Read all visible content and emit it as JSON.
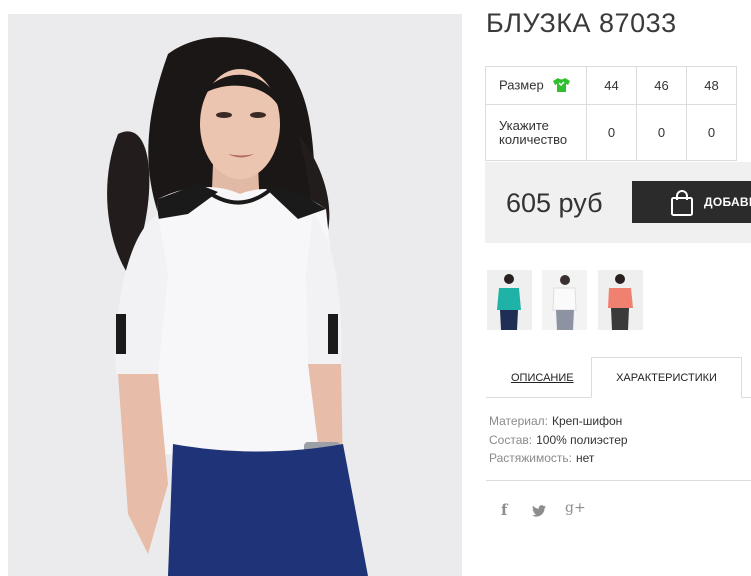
{
  "product": {
    "title": "БЛУЗКА 87033",
    "size_label": "Размер",
    "qty_label_1": "Укажите",
    "qty_label_2": "количество",
    "sizes": [
      "44",
      "46",
      "48"
    ],
    "quantities": [
      "0",
      "0",
      "0"
    ],
    "price": "605 руб",
    "add_button": "ДОБАВИТЬ"
  },
  "tabs": {
    "description": "ОПИСАНИЕ",
    "characteristics": "ХАРАКТЕРИСТИКИ"
  },
  "specs": [
    {
      "key": "Материал:",
      "value": "Креп-шифон"
    },
    {
      "key": "Состав:",
      "value": "100% полиэстер"
    },
    {
      "key": "Растяжимость:",
      "value": "нет"
    }
  ],
  "social": {
    "facebook": "f",
    "gplus": "g+"
  },
  "colors": {
    "size_icon": "#2fbf2f",
    "button_bg": "#2b2b2b",
    "price_bg": "#f0f0f0",
    "thumb_teal": "#1fb3a7",
    "thumb_white": "#f4f4f4",
    "thumb_coral": "#f08070"
  },
  "icons": [
    "tshirt-icon",
    "shopping-bag-icon",
    "facebook-icon",
    "twitter-icon",
    "google-plus-icon"
  ]
}
